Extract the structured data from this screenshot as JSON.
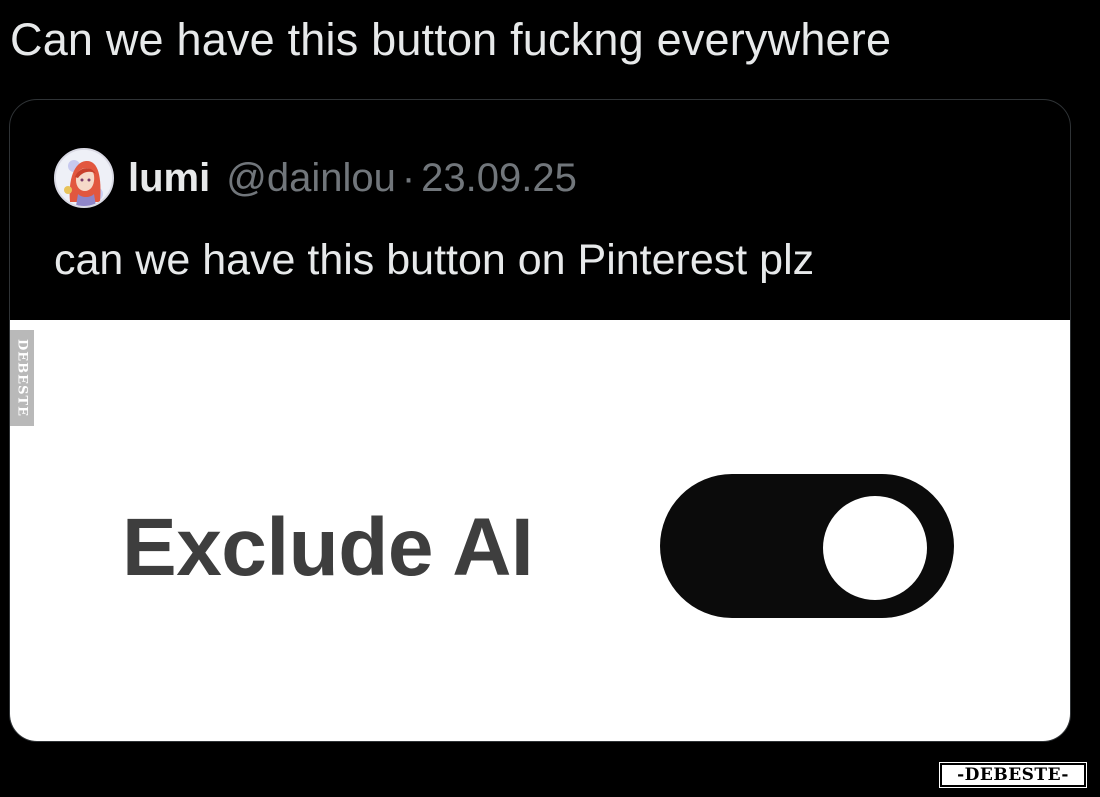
{
  "post": {
    "text": "Can we have this button fuckng everywhere"
  },
  "quoted_post": {
    "author_name": "lumi",
    "author_handle": "@dainlou",
    "separator": "·",
    "date": "23.09.25",
    "text": "can we have this button on Pinterest plz",
    "avatar_icon": "anime-avatar-icon"
  },
  "media": {
    "toggle_label": "Exclude AI",
    "toggle_state": "on",
    "side_watermark": "DEBESTE"
  },
  "watermark": {
    "text": "-DEBESTE-"
  },
  "colors": {
    "background": "#000000",
    "text_primary": "#e7e9ea",
    "text_secondary": "#71767b",
    "card_border": "#2f3336",
    "toggle_track": "#0b0b0b",
    "toggle_knob": "#ffffff",
    "label_text": "#3e3e3e"
  }
}
